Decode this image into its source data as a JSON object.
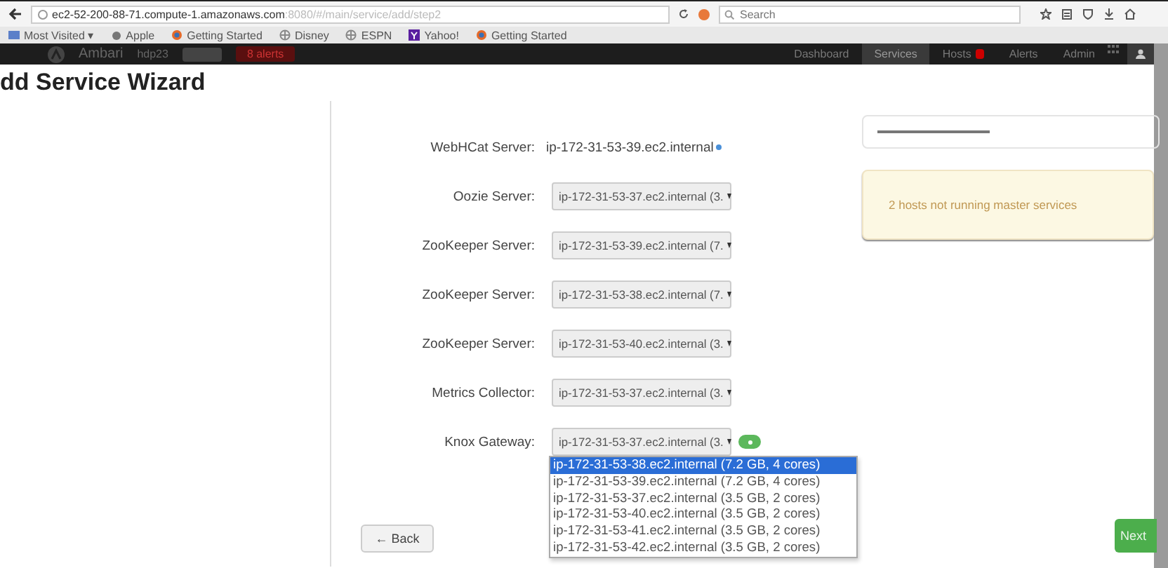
{
  "browser": {
    "url": "ec2-52-200-88-71.compute-1.amazonaws.com",
    "url_path": ":8080/#/main/service/add/step2",
    "search": {
      "placeholder": "Search"
    },
    "bookmarks": [
      {
        "label": "Most Visited ▾",
        "kind": "folder"
      },
      {
        "label": "Apple",
        "kind": "apple"
      },
      {
        "label": "Getting Started",
        "kind": "firefox"
      },
      {
        "label": "Disney",
        "kind": "globe"
      },
      {
        "label": "ESPN",
        "kind": "globe"
      },
      {
        "label": "Yahoo!",
        "kind": "yahoo"
      },
      {
        "label": "Getting Started",
        "kind": "firefox"
      }
    ]
  },
  "app_nav": {
    "brand": "Ambari",
    "cluster": "hdp23",
    "alerts": "8 alerts",
    "items": [
      {
        "label": "Dashboard",
        "selected": false,
        "badge": false
      },
      {
        "label": "Services",
        "selected": true,
        "badge": false
      },
      {
        "label": "Hosts",
        "selected": false,
        "badge": true
      },
      {
        "label": "Alerts",
        "selected": false,
        "badge": false
      },
      {
        "label": "Admin",
        "selected": false,
        "badge": false
      }
    ]
  },
  "title": "dd Service Wizard",
  "form": [
    {
      "label": "WebHCat Server:",
      "kind": "text",
      "value": "ip-172-31-53-39.ec2.internal"
    },
    {
      "label": "Oozie Server:",
      "kind": "select",
      "value": "ip-172-31-53-37.ec2.internal (3."
    },
    {
      "label": "ZooKeeper Server:",
      "kind": "select",
      "value": "ip-172-31-53-39.ec2.internal (7."
    },
    {
      "label": "ZooKeeper Server:",
      "kind": "select",
      "value": "ip-172-31-53-38.ec2.internal (7."
    },
    {
      "label": "ZooKeeper Server:",
      "kind": "select",
      "value": "ip-172-31-53-40.ec2.internal (3."
    },
    {
      "label": "Metrics Collector:",
      "kind": "select",
      "value": "ip-172-31-53-37.ec2.internal (3."
    },
    {
      "label": "Knox Gateway:",
      "kind": "select",
      "value": "ip-172-31-53-37.ec2.internal (3.",
      "add_button": true,
      "options": [
        {
          "label": "ip-172-31-53-38.ec2.internal (7.2 GB, 4 cores)",
          "selected": true
        },
        {
          "label": "ip-172-31-53-39.ec2.internal (7.2 GB, 4 cores)",
          "selected": false
        },
        {
          "label": "ip-172-31-53-37.ec2.internal (3.5 GB, 2 cores)",
          "selected": false
        },
        {
          "label": "ip-172-31-53-40.ec2.internal (3.5 GB, 2 cores)",
          "selected": false
        },
        {
          "label": "ip-172-31-53-41.ec2.internal (3.5 GB, 2 cores)",
          "selected": false
        },
        {
          "label": "ip-172-31-53-42.ec2.internal (3.5 GB, 2 cores)",
          "selected": false
        }
      ]
    }
  ],
  "alert": "2 hosts not running master services",
  "buttons": {
    "back": "← Back",
    "next": "Next"
  }
}
